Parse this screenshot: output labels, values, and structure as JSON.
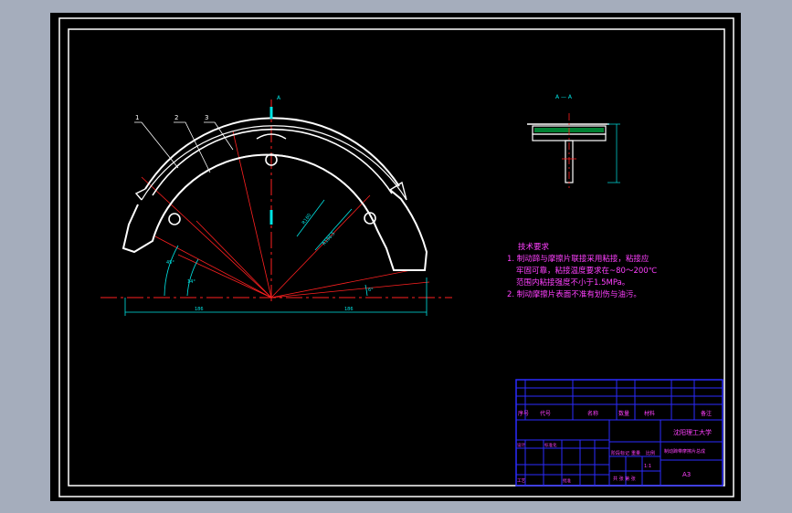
{
  "section_title": "A — A",
  "view_marker": "A",
  "part_labels": [
    "1",
    "2",
    "3"
  ],
  "dimensions": {
    "left_horizontal": "186",
    "right_horizontal": "186",
    "radius_inner": "R160",
    "radius_outer": "R186.5",
    "angle_a": "45°",
    "angle_b": "14°",
    "angle_c": "6°"
  },
  "notes": {
    "heading": "技术要求",
    "line1": "1. 制动蹄与摩擦片联接采用粘接，粘接应",
    "line2": "牢固可靠，粘接温度要求在~80～200℃",
    "line3": "范围内粘接强度不小于1.5MPa。",
    "line4": "2. 制动摩擦片表面不准有划伤与油污。"
  },
  "title_block": {
    "university": "沈阳理工大学",
    "drawing_name": "制动蹄带摩擦片总成",
    "sheet_size": "A3",
    "scale": "1:1",
    "col_seq": "序号",
    "col_code": "代号",
    "col_name": "名称",
    "col_material": "材料",
    "col_qty": "数量",
    "col_note": "备注",
    "designer": "设计",
    "standard": "标准化",
    "mark": "阶段标记",
    "weight": "重量",
    "ratio": "比例",
    "process": "工艺",
    "approve": "批准",
    "sheets": "共 张 第 张"
  },
  "colors": {
    "frame": "#ffffff",
    "drawing": "#ffffff",
    "centerline": "#ff2020",
    "dimension": "#00e5e5",
    "text": "#ff40ff",
    "title_block": "#2b2bff",
    "hatch": "#00c040"
  }
}
